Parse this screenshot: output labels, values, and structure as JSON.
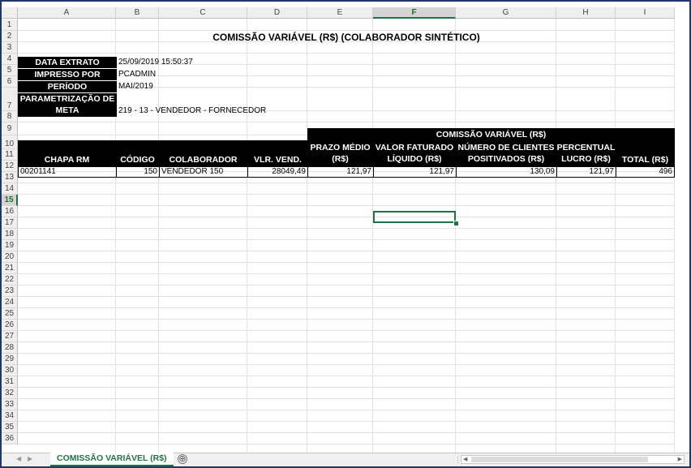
{
  "columns": [
    "A",
    "B",
    "C",
    "D",
    "E",
    "F",
    "G",
    "H",
    "I"
  ],
  "selected_column": "F",
  "rows": [
    "1",
    "2",
    "3",
    "4",
    "5",
    "6",
    "7",
    "8",
    "9",
    "10",
    "11",
    "12",
    "13",
    "14",
    "15",
    "16",
    "17",
    "18",
    "19",
    "20",
    "21",
    "22",
    "23",
    "24",
    "25",
    "26",
    "27",
    "28",
    "29",
    "30",
    "31",
    "32",
    "33",
    "34",
    "35",
    "36"
  ],
  "selected_row": "15",
  "report": {
    "title": "COMISSÃO VARIÁVEL (R$) (COLABORADOR SINTÉTICO)",
    "info": [
      {
        "label": "DATA EXTRATO",
        "value": "25/09/2019 15:50:37"
      },
      {
        "label": "IMPRESSO POR",
        "value": "PCADMIN"
      },
      {
        "label": "PERÍODO",
        "value": "MAI/2019"
      },
      {
        "label_line1": "PARAMETRIZAÇÃO DE",
        "label_line2": "META",
        "value": "219 - 13 - VENDEDOR - FORNECEDOR"
      }
    ],
    "group_header": "COMISSÃO VARIÁVEL (R$)",
    "headers": {
      "chapa": "CHAPA RM",
      "codigo": "CÓDIGO",
      "colaborador": "COLABORADOR",
      "vlr_vend": "VLR. VEND.",
      "prazo_1": "PRAZO MÉDIO",
      "prazo_2": "(R$)",
      "valor_1": "VALOR FATURADO",
      "valor_2": "LÍQUIDO (R$)",
      "numero_1": "NÚMERO DE CLIENTES",
      "numero_2": "POSITIVADOS (R$)",
      "perc_1": "PERCENTUAL",
      "perc_2": "LUCRO (R$)",
      "total": "TOTAL (R$)"
    },
    "data_row": {
      "chapa": "00201141",
      "codigo": "150",
      "colaborador": "VENDEDOR 150",
      "vlr_vend": "28049,49",
      "prazo": "121,97",
      "valor": "121,97",
      "numero": "130,09",
      "perc": "121,97",
      "total": "496"
    }
  },
  "sheet_tab": "COMISSÃO VARIÁVEL (R$)",
  "add_sheet_symbol": "⊕",
  "colors": {
    "accent": "#217346",
    "header_bg": "#000000",
    "frame": "#1f3864"
  }
}
